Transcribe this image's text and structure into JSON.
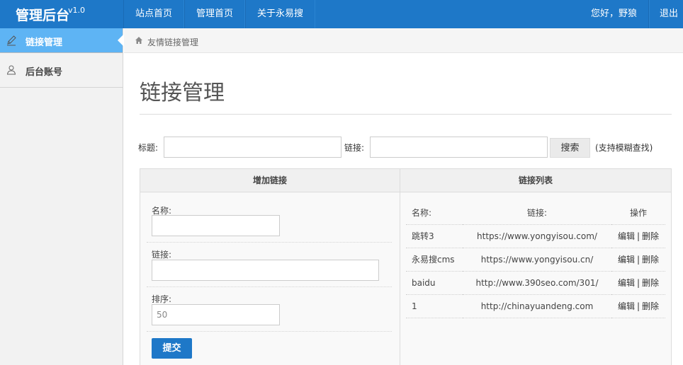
{
  "header": {
    "brand": "管理后台",
    "version": "v1.0",
    "nav": [
      "站点首页",
      "管理首页",
      "关于永易搜"
    ],
    "greeting": "您好，野狼",
    "logout": "退出"
  },
  "sidebar": {
    "items": [
      {
        "label": "链接管理",
        "icon": "pencil-icon",
        "active": true
      },
      {
        "label": "后台账号",
        "icon": "user-icon",
        "active": false
      }
    ]
  },
  "breadcrumb": "友情链接管理",
  "page_title": "链接管理",
  "search": {
    "title_label": "标题:",
    "title_value": "",
    "link_label": "链接:",
    "link_value": "",
    "button": "搜索",
    "hint": "(支持模糊查找)"
  },
  "add_panel": {
    "heading": "增加链接",
    "name_label": "名称:",
    "name_value": "",
    "link_label": "链接:",
    "link_value": "",
    "order_label": "排序:",
    "order_value": "50",
    "submit": "提交"
  },
  "list_panel": {
    "heading": "链接列表",
    "columns": [
      "名称:",
      "链接:",
      "操作"
    ],
    "rows": [
      {
        "name": "跳转3",
        "url": "https://www.yongyisou.com/",
        "edit": "编辑",
        "delete": "删除"
      },
      {
        "name": "永易搜cms",
        "url": "https://www.yongyisou.cn/",
        "edit": "编辑",
        "delete": "删除"
      },
      {
        "name": "baidu",
        "url": "http://www.390seo.com/301/",
        "edit": "编辑",
        "delete": "删除"
      },
      {
        "name": "1",
        "url": "http://chinayuandeng.com",
        "edit": "编辑",
        "delete": "删除"
      }
    ],
    "separator": "|"
  },
  "colors": {
    "topbar": "#1e78c8",
    "sidebar_active": "#5eb4f4",
    "sidebar_bg": "#f2f2f2",
    "submit": "#1e78c8"
  }
}
